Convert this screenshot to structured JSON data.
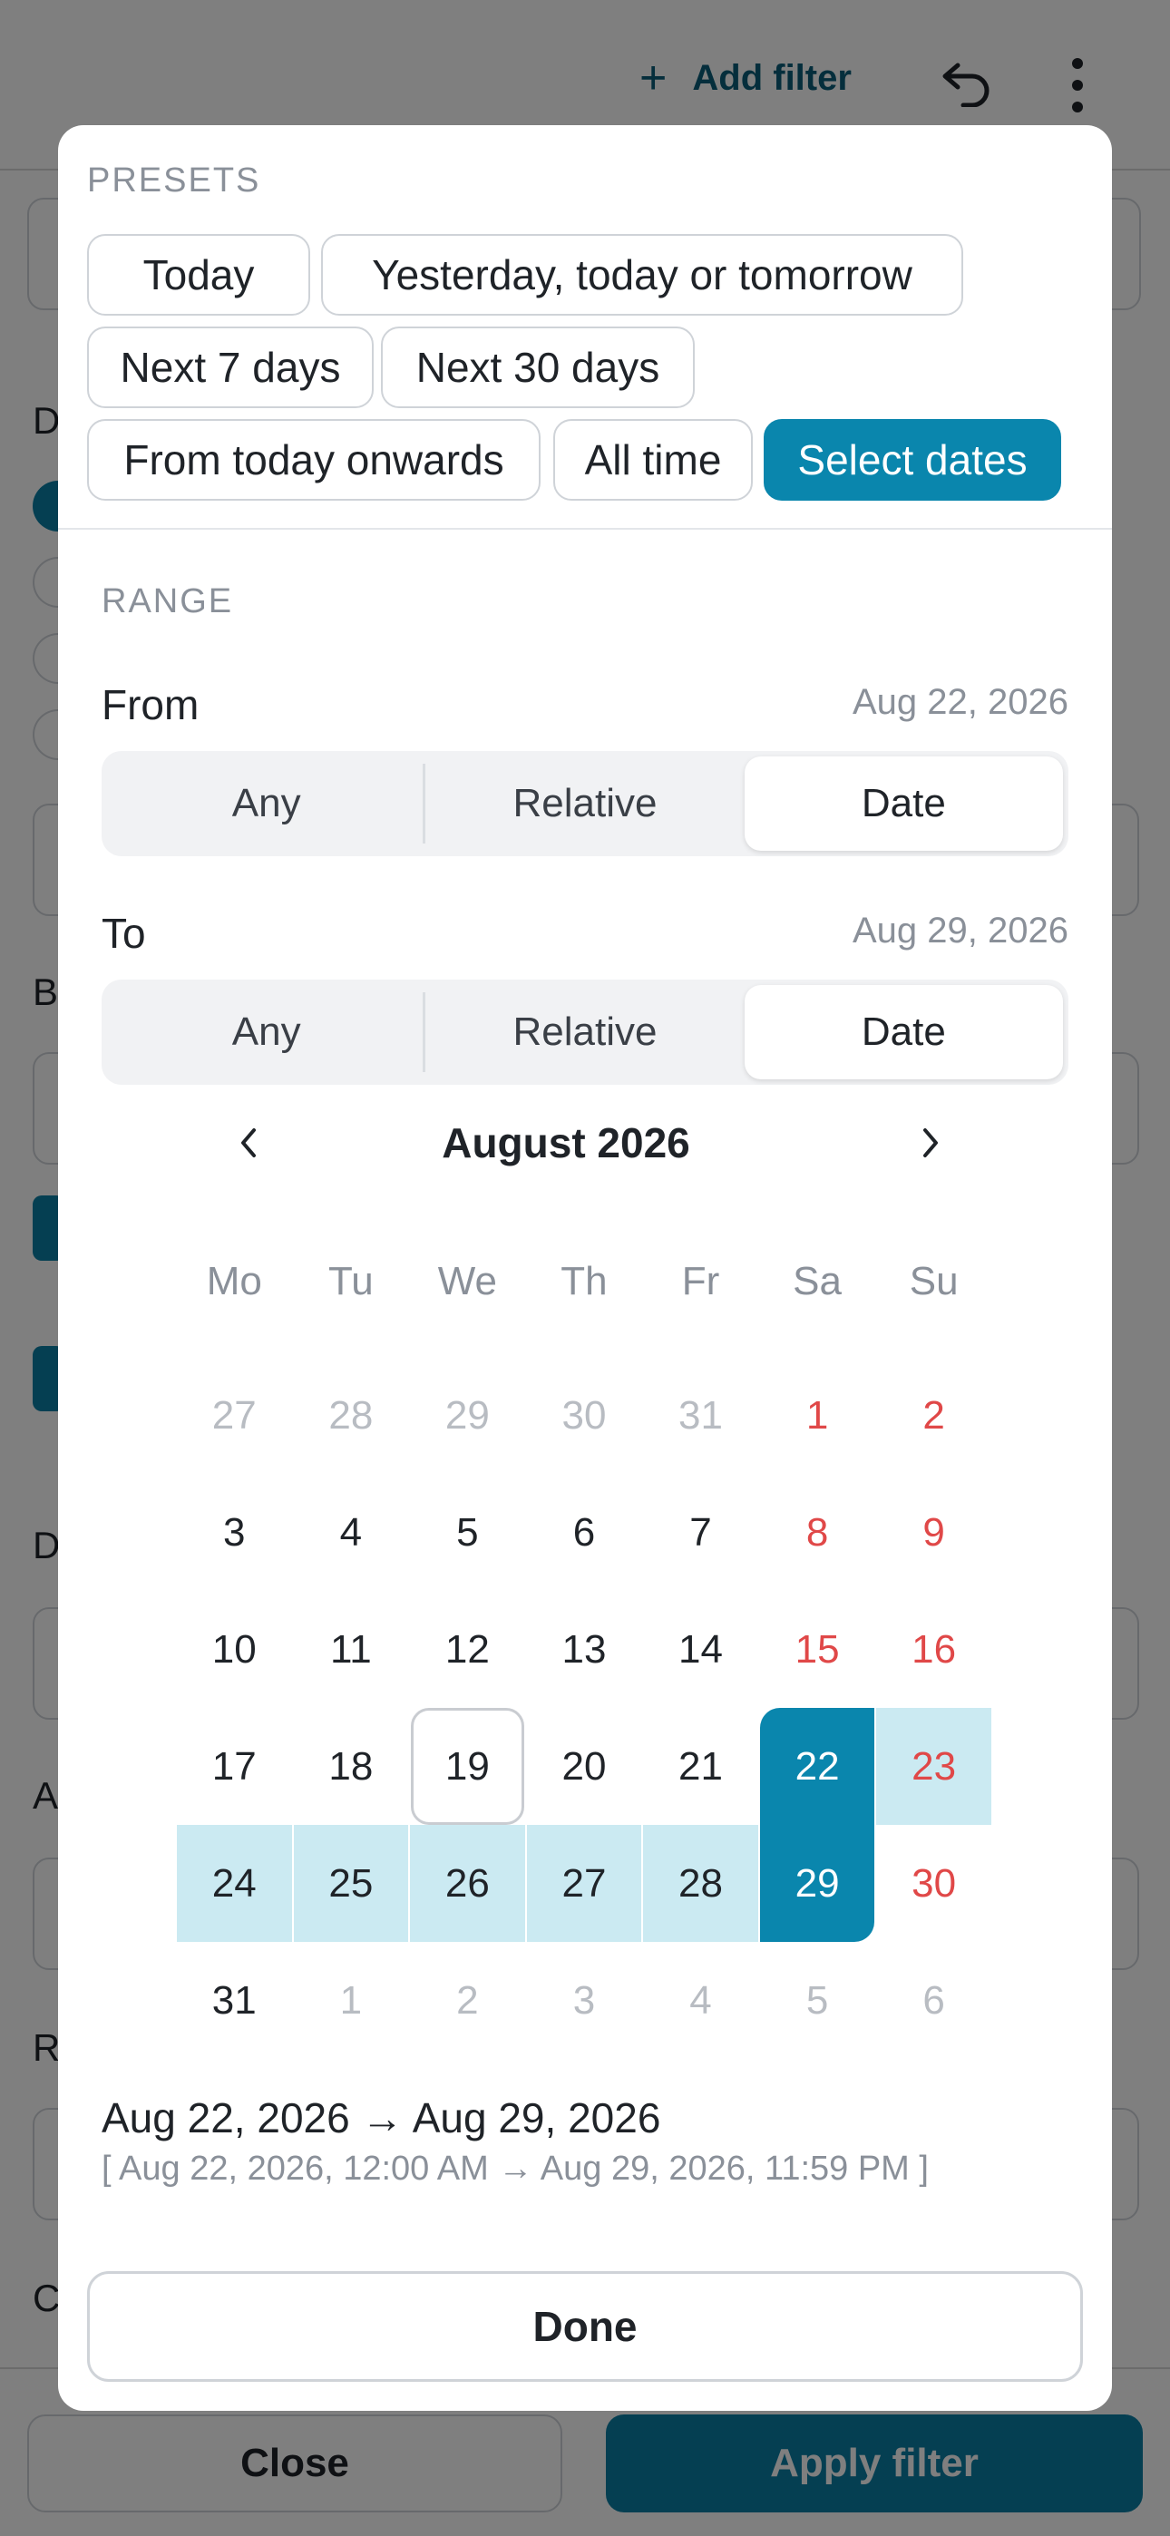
{
  "background": {
    "add_filter_label": "Add filter",
    "side_letters": [
      "D",
      "B",
      "D",
      "A",
      "R",
      "C"
    ],
    "close_label": "Close",
    "apply_label": "Apply filter"
  },
  "presets": {
    "section_label": "PRESETS",
    "chips": [
      {
        "label": "Today"
      },
      {
        "label": "Yesterday, today or tomorrow"
      },
      {
        "label": "Next 7 days"
      },
      {
        "label": "Next 30 days"
      },
      {
        "label": "From today onwards"
      },
      {
        "label": "All time"
      },
      {
        "label": "Select dates"
      }
    ],
    "active_chip": "Select dates"
  },
  "range": {
    "section_label": "RANGE",
    "from": {
      "label": "From",
      "value": "Aug 22, 2026",
      "options": [
        "Any",
        "Relative",
        "Date"
      ],
      "selected": "Date"
    },
    "to": {
      "label": "To",
      "value": "Aug 29, 2026",
      "options": [
        "Any",
        "Relative",
        "Date"
      ],
      "selected": "Date"
    }
  },
  "calendar": {
    "title": "August 2026",
    "weekdays": [
      "Mo",
      "Tu",
      "We",
      "Th",
      "Fr",
      "Sa",
      "Su"
    ],
    "days": [
      [
        "27",
        "28",
        "29",
        "30",
        "31",
        "1",
        "2"
      ],
      [
        "3",
        "4",
        "5",
        "6",
        "7",
        "8",
        "9"
      ],
      [
        "10",
        "11",
        "12",
        "13",
        "14",
        "15",
        "16"
      ],
      [
        "17",
        "18",
        "19",
        "20",
        "21",
        "22",
        "23"
      ],
      [
        "24",
        "25",
        "26",
        "27",
        "28",
        "29",
        "30"
      ],
      [
        "31",
        "1",
        "2",
        "3",
        "4",
        "5",
        "6"
      ]
    ],
    "today": "19",
    "range_start": "22",
    "range_end": "29"
  },
  "summary": {
    "main": "Aug 22, 2026 → Aug 29, 2026",
    "detail": "[ Aug 22, 2026, 12:00 AM → Aug 29, 2026, 11:59 PM ]"
  },
  "done_label": "Done",
  "colors": {
    "accent": "#0a86ad",
    "range_fill": "#cbeaf2",
    "weekend": "#e04848"
  }
}
